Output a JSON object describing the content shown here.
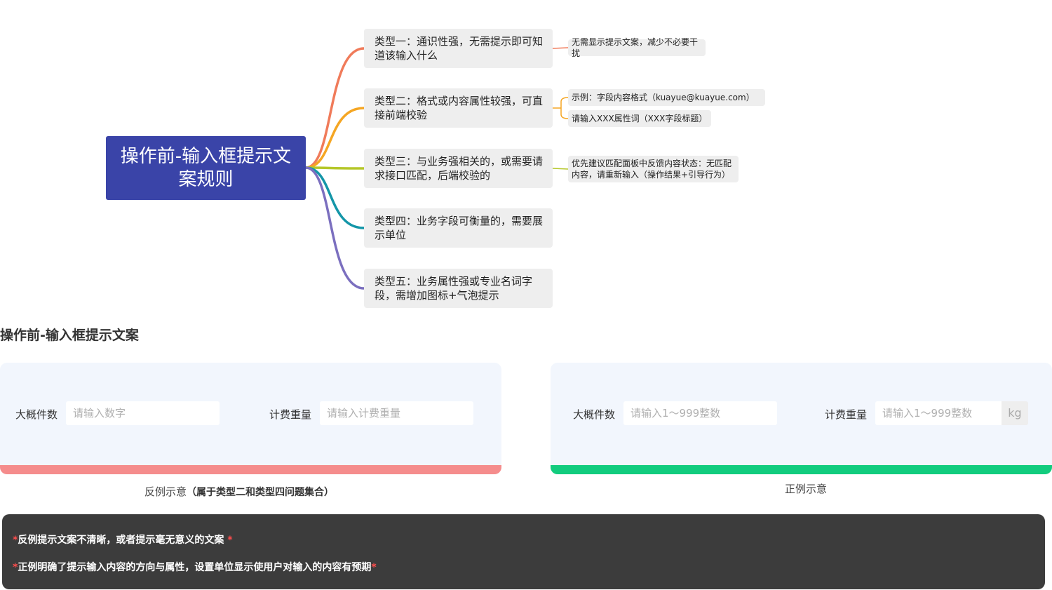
{
  "mindmap": {
    "root": "操作前-输入框提示文案规则",
    "branches": [
      {
        "label": "类型一：通识性强，无需提示即可知道该输入什么",
        "color": "#f07b5a",
        "leaves": [
          "无需显示提示文案，减少不必要干扰"
        ]
      },
      {
        "label": "类型二：格式或内容属性较强，可直接前端校验",
        "color": "#f5a623",
        "leaves": [
          "示例：字段内容格式（kuayue@kuayue.com）",
          "请输入XXX属性词（XXX字段标题）"
        ]
      },
      {
        "label": "类型三：与业务强相关的，或需要请求接口匹配，后端校验的",
        "color": "#b5c72a",
        "leaves": [
          "优先建议匹配面板中反馈内容状态：无匹配内容，请重新输入（操作结果+引导行为）"
        ]
      },
      {
        "label": "类型四：业务字段可衡量的，需要展示单位",
        "color": "#1496a8",
        "leaves": []
      },
      {
        "label": "类型五：业务属性强或专业名词字段，需增加图标+气泡提示",
        "color": "#7b6fbf",
        "leaves": []
      }
    ]
  },
  "section_title": "操作前-输入框提示文案",
  "bad_example": {
    "bar_color": "#f58c8c",
    "field1_label": "大概件数",
    "field1_placeholder": "请输入数字",
    "field2_label": "计费重量",
    "field2_placeholder": "请输入计费重量",
    "caption": "反例示意",
    "caption_note": "（属于类型二和类型四问题集合）"
  },
  "good_example": {
    "bar_color": "#12cc7e",
    "field1_label": "大概件数",
    "field1_placeholder": "请输入1～999整数",
    "field2_label": "计费重量",
    "field2_placeholder": "请输入1～999整数",
    "unit": "kg",
    "caption": "正例示意"
  },
  "notes": {
    "star": "*",
    "line1": "反例提示文案不清晰，或者提示毫无意义的文案",
    "line2": "正例明确了提示输入内容的方向与属性，设置单位显示使用户对输入的内容有预期"
  }
}
